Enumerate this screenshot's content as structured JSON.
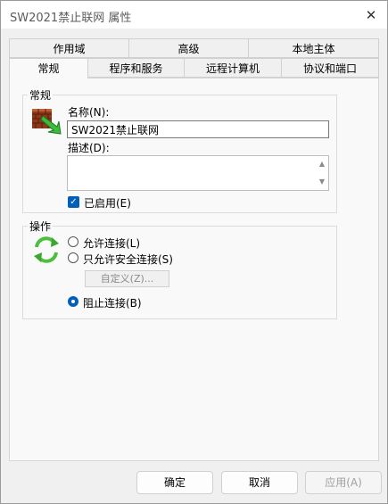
{
  "window": {
    "title": "SW2021禁止联网 属性",
    "close_glyph": "✕"
  },
  "tabs_row1": [
    "作用域",
    "高级",
    "本地主体"
  ],
  "tabs_row2": [
    "常规",
    "程序和服务",
    "远程计算机",
    "协议和端口"
  ],
  "general": {
    "group_label": "常规",
    "name_label": "名称(N):",
    "name_value": "SW2021禁止联网",
    "desc_label": "描述(D):",
    "desc_value": "",
    "enabled_label": "已启用(E)",
    "enabled": true
  },
  "action": {
    "group_label": "操作",
    "allow_label": "允许连接(L)",
    "allow_secure_label": "只允许安全连接(S)",
    "custom_button": "自定义(Z)...",
    "block_label": "阻止连接(B)",
    "selected": "block"
  },
  "footer": {
    "ok": "确定",
    "cancel": "取消",
    "apply": "应用(A)"
  },
  "icons": {
    "rule_icon": "firewall-icon",
    "action_icon": "refresh-arrows-icon"
  },
  "colors": {
    "accent": "#005fb8"
  }
}
